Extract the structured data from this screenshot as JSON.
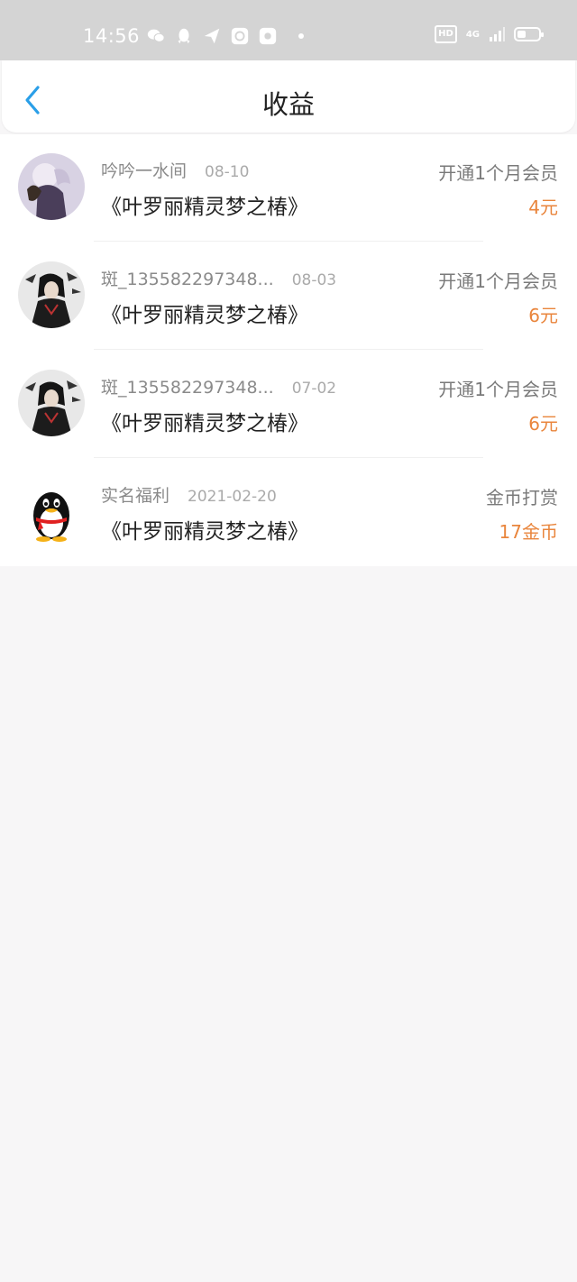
{
  "status_bar": {
    "time": "14:56",
    "hd_badge": "HD",
    "network_type": "4G",
    "battery_level": 0.4,
    "icons": [
      "wechat-icon",
      "qq-icon",
      "send-icon",
      "browser-icon",
      "media-icon"
    ]
  },
  "header": {
    "title": "收益",
    "back_icon": "chevron-left-icon",
    "accent_color": "#2a9fe8"
  },
  "entries": [
    {
      "name": "吟吟一水间",
      "date": "08-10",
      "book": "《叶罗丽精灵梦之椿》",
      "action": "开通1个月会员",
      "amount": "4元",
      "avatar": "anime-girl-avatar"
    },
    {
      "name": "斑_135582297348...",
      "date": "08-03",
      "book": "《叶罗丽精灵梦之椿》",
      "action": "开通1个月会员",
      "amount": "6元",
      "avatar": "anime-character-avatar"
    },
    {
      "name": "斑_135582297348...",
      "date": "07-02",
      "book": "《叶罗丽精灵梦之椿》",
      "action": "开通1个月会员",
      "amount": "6元",
      "avatar": "anime-character-avatar"
    },
    {
      "name": "实名福利",
      "date": "2021-02-20",
      "book": "《叶罗丽精灵梦之椿》",
      "action": "金币打赏",
      "amount": "17金币",
      "avatar": "qq-penguin-avatar"
    }
  ],
  "colors": {
    "amount": "#e9853c",
    "status_bar_bg": "#d4d4d4",
    "page_bg": "#f7f6f7"
  }
}
